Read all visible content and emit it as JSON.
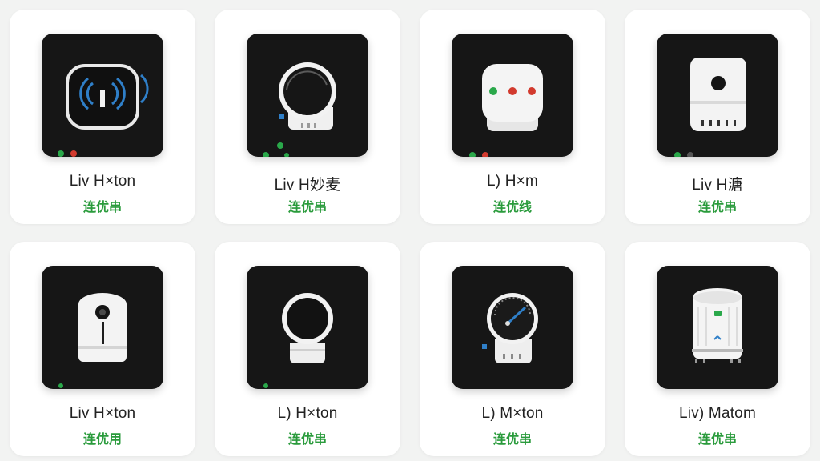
{
  "colors": {
    "background": "#f2f3f2",
    "card": "#ffffff",
    "tile": "#161616",
    "status_green": "#2a9b3c",
    "accent_blue": "#2f7fc8",
    "accent_red": "#d23a2e"
  },
  "devices": [
    {
      "name": "Liv H×ton",
      "status": "连优串",
      "icon": "wifi-hub-icon"
    },
    {
      "name": "Liv H妙麦",
      "status": "连优串",
      "icon": "round-camera-icon"
    },
    {
      "name": "L) H×m",
      "status": "连优线",
      "icon": "indicator-box-icon"
    },
    {
      "name": "Liv H溏",
      "status": "连优串",
      "icon": "camera-speaker-icon"
    },
    {
      "name": "Liv H×ton",
      "status": "连优用",
      "icon": "tower-camera-icon"
    },
    {
      "name": "L) H×ton",
      "status": "连优串",
      "icon": "orb-camera-icon"
    },
    {
      "name": "L) M×ton",
      "status": "连优串",
      "icon": "gauge-device-icon"
    },
    {
      "name": "Liv) Matom",
      "status": "连优串",
      "icon": "air-purifier-icon"
    }
  ]
}
